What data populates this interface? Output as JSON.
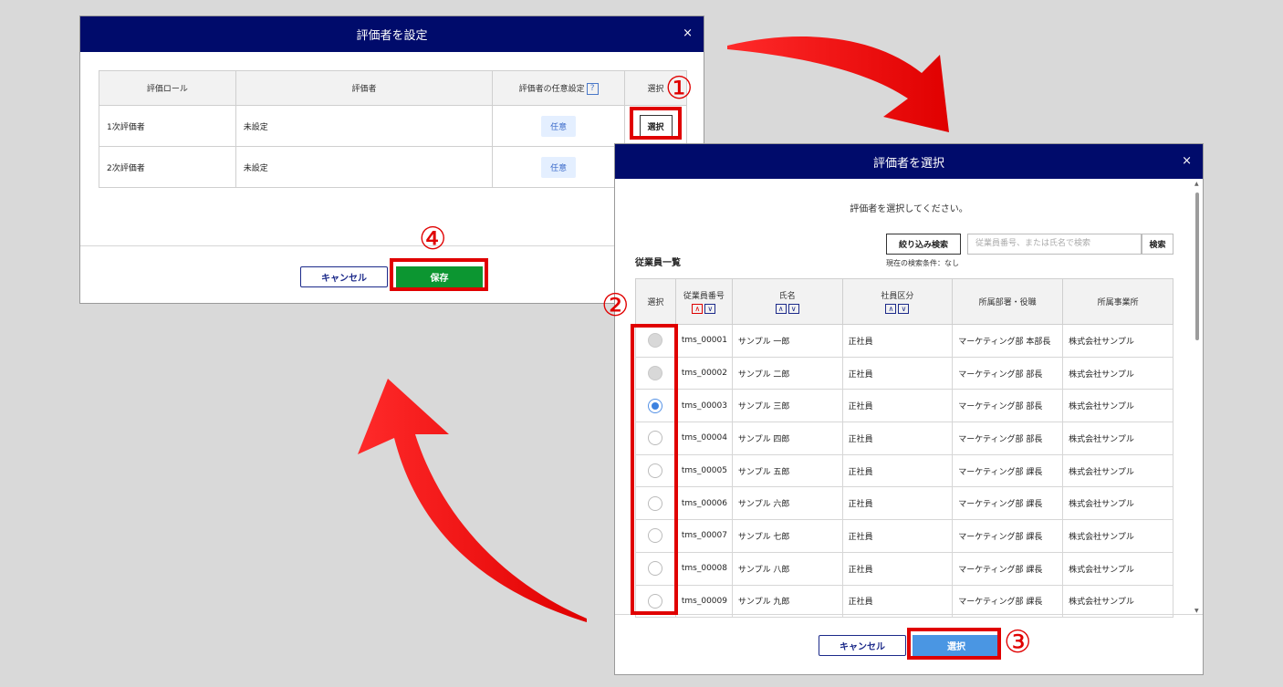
{
  "dialog1": {
    "title": "評価者を設定",
    "close": "×",
    "headers": [
      "評価ロール",
      "評価者",
      "評価者の任意設定",
      "選択"
    ],
    "help": "?",
    "rows": [
      {
        "role": "1次評価者",
        "evaluator": "未設定",
        "optional": "任意",
        "select": "選択"
      },
      {
        "role": "2次評価者",
        "evaluator": "未設定",
        "optional": "任意",
        "select": ""
      }
    ],
    "cancel": "キャンセル",
    "save": "保存"
  },
  "dialog2": {
    "title": "評価者を選択",
    "close": "×",
    "instruction": "評価者を選択してください。",
    "filter_button": "絞り込み検索",
    "search_placeholder": "従業員番号、または氏名で検索",
    "search_button": "検索",
    "condition": "現在の検索条件：なし",
    "list_title": "従業員一覧",
    "headers": [
      "選択",
      "従業員番号",
      "氏名",
      "社員区分",
      "所属部署・役職",
      "所属事業所"
    ],
    "employees": [
      {
        "radio": "disabled",
        "id": "tms_00001",
        "name": "サンプル 一郎",
        "type": "正社員",
        "dept": "マーケティング部 本部長",
        "office": "株式会社サンプル"
      },
      {
        "radio": "disabled",
        "id": "tms_00002",
        "name": "サンプル 二郎",
        "type": "正社員",
        "dept": "マーケティング部 部長",
        "office": "株式会社サンプル"
      },
      {
        "radio": "checked",
        "id": "tms_00003",
        "name": "サンプル 三郎",
        "type": "正社員",
        "dept": "マーケティング部 部長",
        "office": "株式会社サンプル"
      },
      {
        "radio": "",
        "id": "tms_00004",
        "name": "サンプル 四郎",
        "type": "正社員",
        "dept": "マーケティング部 部長",
        "office": "株式会社サンプル"
      },
      {
        "radio": "",
        "id": "tms_00005",
        "name": "サンプル 五郎",
        "type": "正社員",
        "dept": "マーケティング部 課長",
        "office": "株式会社サンプル"
      },
      {
        "radio": "",
        "id": "tms_00006",
        "name": "サンプル 六郎",
        "type": "正社員",
        "dept": "マーケティング部 課長",
        "office": "株式会社サンプル"
      },
      {
        "radio": "",
        "id": "tms_00007",
        "name": "サンプル 七郎",
        "type": "正社員",
        "dept": "マーケティング部 課長",
        "office": "株式会社サンプル"
      },
      {
        "radio": "",
        "id": "tms_00008",
        "name": "サンプル 八郎",
        "type": "正社員",
        "dept": "マーケティング部 課長",
        "office": "株式会社サンプル"
      },
      {
        "radio": "",
        "id": "tms_00009",
        "name": "サンプル 九郎",
        "type": "正社員",
        "dept": "マーケティング部 課長",
        "office": "株式会社サンプル"
      }
    ],
    "cancel": "キャンセル",
    "select": "選択"
  },
  "annotations": {
    "step1": "①",
    "step2": "②",
    "step3": "③",
    "step4": "④",
    "color": "#e00000"
  }
}
